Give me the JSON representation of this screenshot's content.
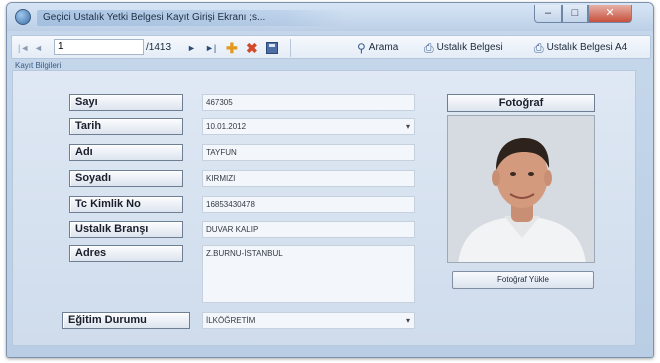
{
  "window": {
    "title": "Geçici Ustalık Yetki Belgesi Kayıt Girişi Ekranı ;s...",
    "minimize": "–",
    "maximize": "□",
    "close": "✕"
  },
  "toolbar": {
    "first": "|◄",
    "prev": "◄",
    "record_index": "1",
    "record_total": "/1413",
    "next": "►",
    "last": "►|",
    "add": "✚",
    "delete": "✖",
    "search_label": "Arama",
    "cert1_label": "Ustalık Belgesi",
    "cert2_label": "Ustalık Belgesi A4"
  },
  "form": {
    "group_label": "Kayıt Bilgileri",
    "fields": {
      "sayi": {
        "label": "Sayı",
        "value": "467305"
      },
      "tarih": {
        "label": "Tarih",
        "value": "10.01.2012"
      },
      "adi": {
        "label": "Adı",
        "value": "TAYFUN"
      },
      "soyadi": {
        "label": "Soyadı",
        "value": "KIRMIZI"
      },
      "tc": {
        "label": "Tc Kimlik No",
        "value": "16853430478"
      },
      "brans": {
        "label": "Ustalık Branşı",
        "value": "DUVAR KALIP"
      },
      "adres": {
        "label": "Adres",
        "value": "Z.BURNU-İSTANBUL"
      },
      "egitim": {
        "label": "Eğitim Durumu",
        "value": "İLKÖĞRETİM"
      }
    },
    "dropdown_arrow": "▾"
  },
  "photo": {
    "title": "Fotoğraf",
    "upload_label": "Fotoğraf Yükle"
  }
}
